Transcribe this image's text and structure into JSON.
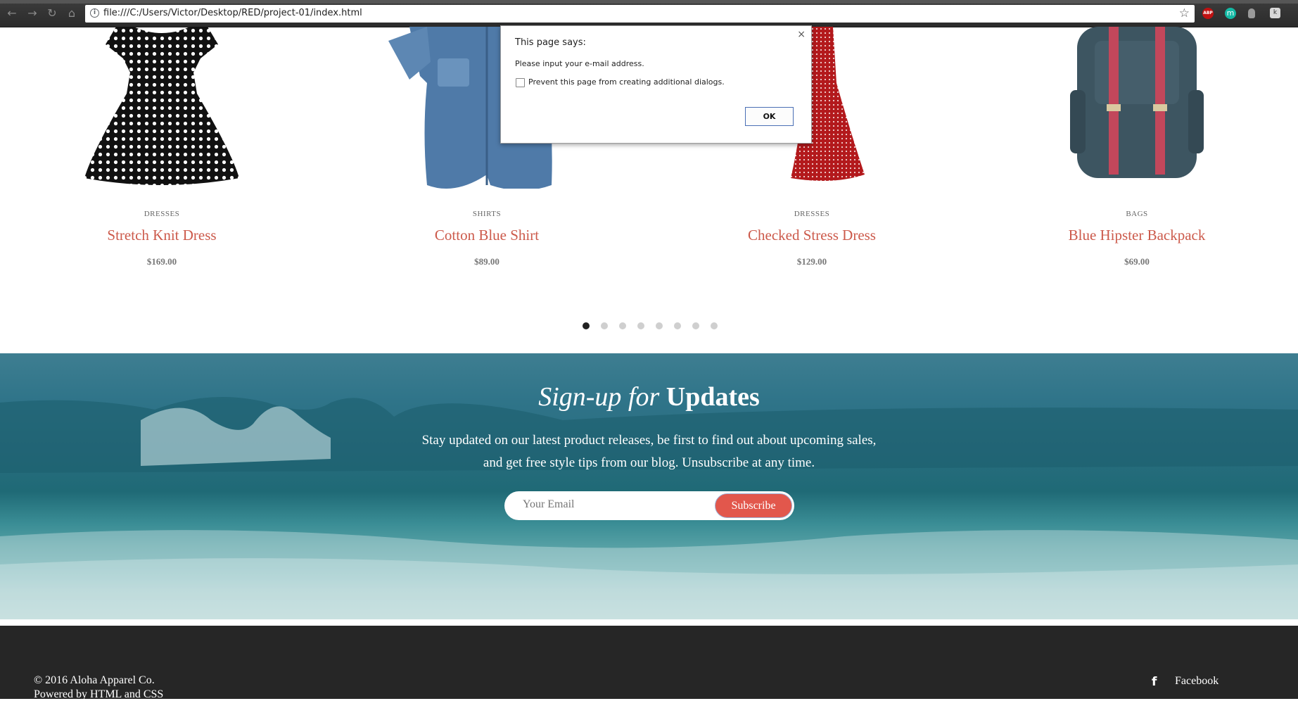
{
  "browser": {
    "url": "file:///C:/Users/Victor/Desktop/RED/project-01/index.html",
    "extensions": [
      "ABP",
      "m",
      "",
      "k"
    ]
  },
  "products": [
    {
      "category": "DRESSES",
      "name": "Stretch Knit Dress",
      "price": "$169.00",
      "image": "polka-dot-dress"
    },
    {
      "category": "SHIRTS",
      "name": "Cotton Blue Shirt",
      "price": "$89.00",
      "image": "denim-shirt"
    },
    {
      "category": "DRESSES",
      "name": "Checked Stress Dress",
      "price": "$129.00",
      "image": "red-dotted-dress"
    },
    {
      "category": "BAGS",
      "name": "Blue Hipster Backpack",
      "price": "$69.00",
      "image": "backpack"
    }
  ],
  "carousel": {
    "pages": 8,
    "active": 1
  },
  "signup": {
    "title_italic": "Sign-up for",
    "title_bold": "Updates",
    "desc_line1": "Stay updated on our latest product releases, be first to find out about upcoming sales,",
    "desc_line2": "and get free style tips from our blog. Unsubscribe at any time.",
    "email_placeholder": "Your Email",
    "button": "Subscribe"
  },
  "footer": {
    "copyright": "© 2016 Aloha Apparel Co.",
    "powered": "Powered by HTML and CSS",
    "social_label": "Facebook",
    "social_icon": "f"
  },
  "dialog": {
    "title": "This page says:",
    "close": "×",
    "message": "Please input your e-mail address.",
    "checkbox_label": "Prevent this page from creating additional dialogs.",
    "ok": "OK"
  },
  "colors": {
    "accent": "#e2574c",
    "product_name": "#cc5a4b",
    "footer_bg": "#262626"
  }
}
